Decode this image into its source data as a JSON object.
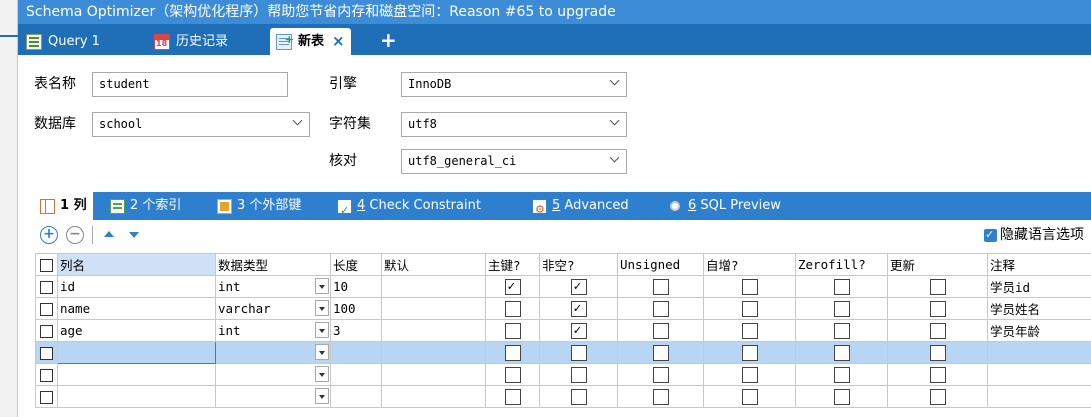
{
  "banner": {
    "text": "Schema Optimizer（架构优化程序）帮助您节省内存和磁盘空间：Reason #65 to upgrade"
  },
  "tabs": [
    {
      "label": "Query 1",
      "icon": "query-icon"
    },
    {
      "label": "历史记录",
      "icon": "calendar-icon"
    },
    {
      "label": "新表",
      "icon": "new-table-icon",
      "active": true
    }
  ],
  "form": {
    "table_name_label": "表名称",
    "table_name_value": "student",
    "database_label": "数据库",
    "database_value": "school",
    "engine_label": "引擎",
    "engine_value": "InnoDB",
    "charset_label": "字符集",
    "charset_value": "utf8",
    "collation_label": "核对",
    "collation_value": "utf8_general_ci"
  },
  "subtabs": [
    {
      "num": "1",
      "label": "列",
      "icon": "columns-icon",
      "active": true
    },
    {
      "num": "2",
      "label": "个索引",
      "icon": "index-icon"
    },
    {
      "num": "3",
      "label": "个外部键",
      "icon": "foreign-key-icon"
    },
    {
      "num": "4",
      "label": "Check Constraint",
      "icon": "check-constraint-icon"
    },
    {
      "num": "5",
      "label": "Advanced",
      "icon": "advanced-icon"
    },
    {
      "num": "6",
      "label": "SQL Preview",
      "icon": "sql-preview-icon"
    }
  ],
  "toolbar": {
    "hide_language_options": "隐藏语言选项"
  },
  "grid": {
    "headers": [
      "列名",
      "数据类型",
      "长度",
      "默认",
      "主键?",
      "非空?",
      "Unsigned",
      "自增?",
      "Zerofill?",
      "更新",
      "注释"
    ],
    "rows": [
      {
        "name": "id",
        "type": "int",
        "length": "10",
        "default": "",
        "pk": true,
        "notnull": true,
        "unsigned": false,
        "autoinc": false,
        "zerofill": false,
        "update": false,
        "comment": "学员id"
      },
      {
        "name": "name",
        "type": "varchar",
        "length": "100",
        "default": "",
        "pk": false,
        "notnull": true,
        "unsigned": false,
        "autoinc": false,
        "zerofill": false,
        "update": false,
        "comment": "学员姓名"
      },
      {
        "name": "age",
        "type": "int",
        "length": "3",
        "default": "",
        "pk": false,
        "notnull": true,
        "unsigned": false,
        "autoinc": false,
        "zerofill": false,
        "update": false,
        "comment": "学员年龄"
      },
      {
        "name": "",
        "type": "",
        "length": "",
        "default": "",
        "pk": false,
        "notnull": false,
        "unsigned": false,
        "autoinc": false,
        "zerofill": false,
        "update": false,
        "comment": "",
        "selected": true
      },
      {
        "name": "",
        "type": "",
        "length": "",
        "default": "",
        "pk": false,
        "notnull": false,
        "unsigned": false,
        "autoinc": false,
        "zerofill": false,
        "update": false,
        "comment": ""
      },
      {
        "name": "",
        "type": "",
        "length": "",
        "default": "",
        "pk": false,
        "notnull": false,
        "unsigned": false,
        "autoinc": false,
        "zerofill": false,
        "update": false,
        "comment": ""
      }
    ]
  },
  "colors": {
    "banner": "#3c8cd7",
    "tabbar": "#1f6fb8",
    "subtabs": "#2f7fcf",
    "selected_row": "#b9d5f4"
  }
}
